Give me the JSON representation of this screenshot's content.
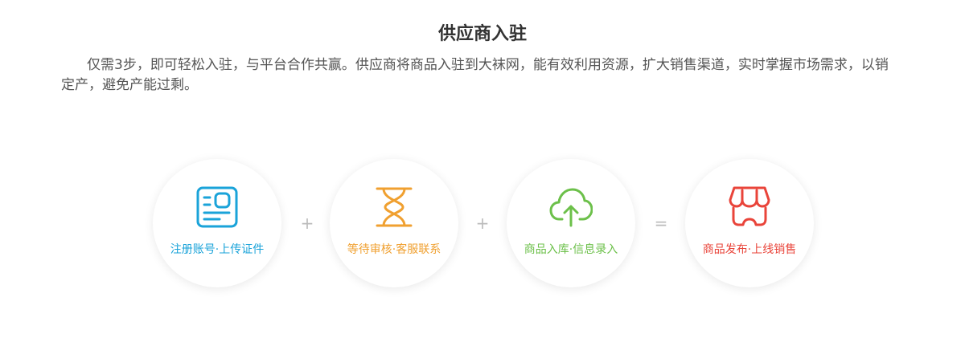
{
  "header": {
    "title": "供应商入驻",
    "intro": "仅需3步，即可轻松入驻，与平台合作共赢。供应商将商品入驻到大袜网，能有效利用资源，扩大销售渠道，实时掌握市场需求，以销定产，避免产能过剩。"
  },
  "steps": [
    {
      "label": "注册账号·上传证件",
      "icon": "id-card-icon",
      "color": "#1aa3d9"
    },
    {
      "label": "等待审核·客服联系",
      "icon": "hourglass-icon",
      "color": "#f0a030"
    },
    {
      "label": "商品入库·信息录入",
      "icon": "cloud-upload-icon",
      "color": "#6cc04a"
    },
    {
      "label": "商品发布·上线销售",
      "icon": "shop-icon",
      "color": "#e9443a"
    }
  ],
  "operators": [
    "+",
    "+",
    "="
  ]
}
